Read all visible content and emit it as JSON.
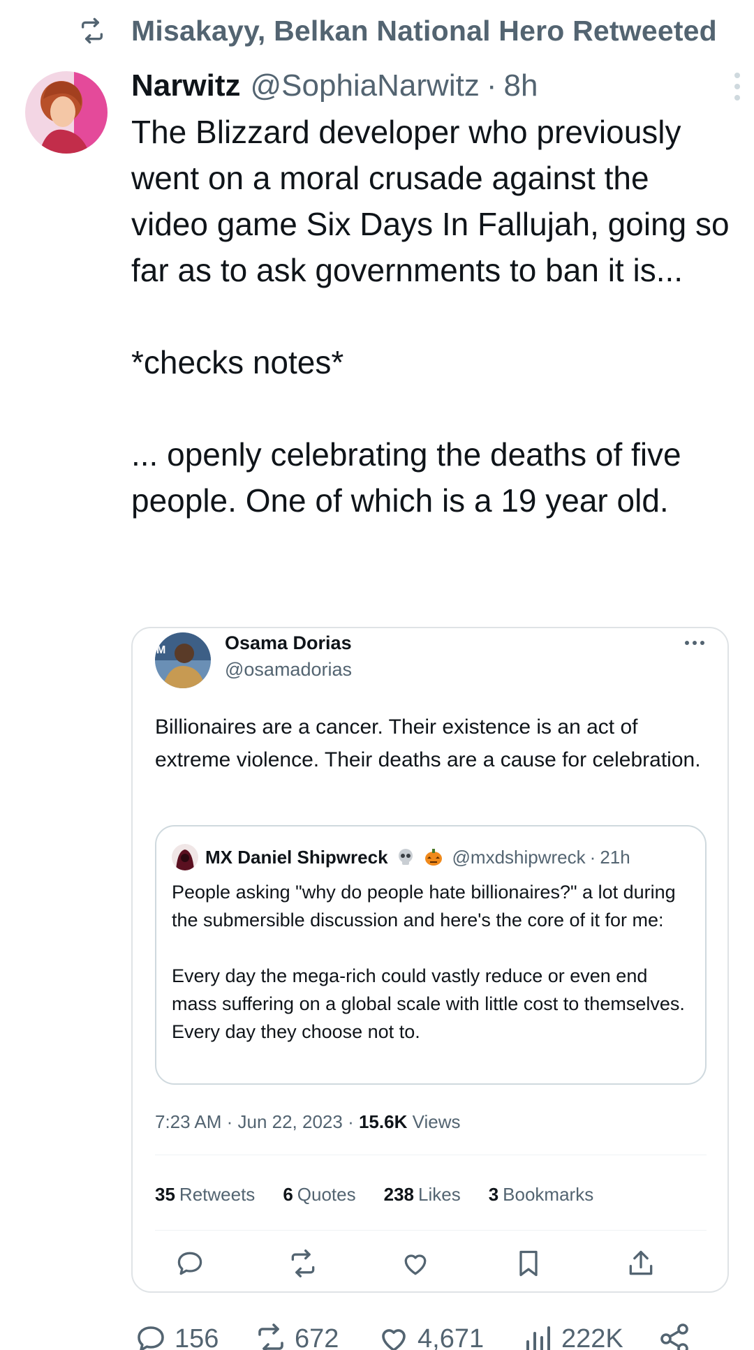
{
  "retweet_banner": {
    "text": "Misakayy, Belkan National Hero Retweeted",
    "icon": "retweet-icon"
  },
  "tweet": {
    "author_name": "Narwitz",
    "author_handle": "@SophiaNarwitz",
    "separator": "·",
    "time": "8h",
    "text": "The Blizzard developer who previously went on a moral crusade against the video game Six Days In Fallujah, going so far as to ask governments to ban it is...\n\n*checks notes*\n\n... openly celebrating the deaths of five people. One of which is a 19 year old."
  },
  "quoted_tweet": {
    "author_name": "Osama Dorias",
    "author_handle": "@osamadorias",
    "text": "Billionaires are a cancer. Their existence is an act of extreme violence. Their deaths are a cause for celebration.",
    "inner_quote": {
      "author_name": "MX Daniel Shipwreck",
      "author_handle": "@mxdshipwreck",
      "separator": "·",
      "time": "21h",
      "text": "People asking \"why do people hate billionaires?\" a lot during the submersible discussion and here's the core of it for me:\n\nEvery day the mega-rich could vastly reduce or even end mass suffering on a global scale with little cost to themselves. Every day they choose not to."
    },
    "timestamp": "7:23 AM · Jun 22, 2023 ·",
    "views_count": "15.6K",
    "views_label": "Views",
    "stats": [
      {
        "count": "35",
        "label": "Retweets"
      },
      {
        "count": "6",
        "label": "Quotes"
      },
      {
        "count": "238",
        "label": "Likes"
      },
      {
        "count": "3",
        "label": "Bookmarks"
      }
    ]
  },
  "actions": {
    "replies": "156",
    "retweets": "672",
    "likes": "4,671",
    "views": "222K"
  },
  "colors": {
    "text": "#0f1419",
    "secondary": "#536471",
    "border": "#dfe3e6"
  }
}
